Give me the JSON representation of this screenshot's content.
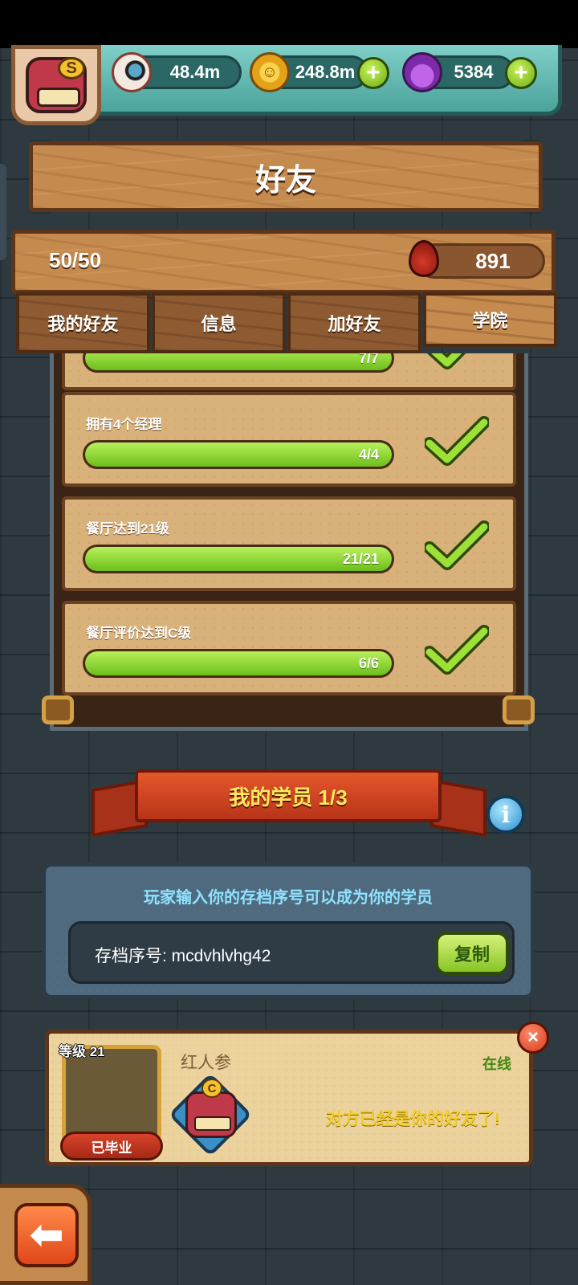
{
  "resources": {
    "eyes": "48.4m",
    "coins": "248.8m",
    "potions": "5384",
    "plus": "+"
  },
  "player": {
    "badge": "S"
  },
  "header": {
    "title": "好友"
  },
  "friends": {
    "count": "50/50",
    "blood": "891"
  },
  "tabs": [
    {
      "label": "我的好友",
      "active": false
    },
    {
      "label": "信息",
      "active": false
    },
    {
      "label": "加好友",
      "active": false
    },
    {
      "label": "学院",
      "active": true
    }
  ],
  "tasks": [
    {
      "title": "",
      "progress": "7/7",
      "fraction": 1.0
    },
    {
      "title": "拥有4个经理",
      "progress": "4/4",
      "fraction": 1.0
    },
    {
      "title": "餐厅达到21级",
      "progress": "21/21",
      "fraction": 1.0
    },
    {
      "title": "餐厅评价达到C级",
      "progress": "6/6",
      "fraction": 1.0
    }
  ],
  "students": {
    "banner": "我的学员 1/3",
    "info": "i",
    "hint": "玩家输入你的存档序号可以成为你的学员",
    "code_label": "存档序号: mcdvhlvhg42",
    "copy": "复制"
  },
  "student_card": {
    "level": "等级 21",
    "status": "已毕业",
    "name": "红人参",
    "online": "在线",
    "badge": "C",
    "message": "对方已经是你的好友了!",
    "close": "×"
  },
  "nav": {
    "back": "⬅"
  },
  "colors": {
    "progress_green": "#7ccc20",
    "wood": "#c58a4e",
    "online_green": "#3f8a10"
  }
}
